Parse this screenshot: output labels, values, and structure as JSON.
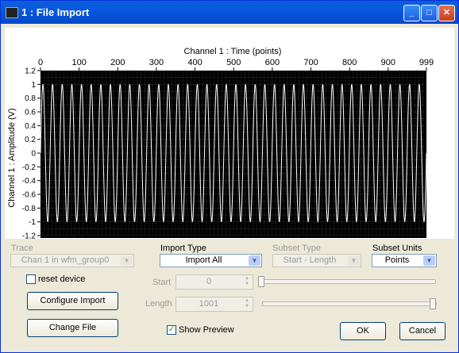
{
  "window": {
    "title": "1 : File Import",
    "minimize": "_",
    "maximize": "□",
    "close": "✕"
  },
  "chart_data": {
    "type": "line",
    "title": "",
    "xlabel": "Channel 1 : Time (points)",
    "ylabel": "Channel 1 : Amplitude (V)",
    "xlim": [
      0,
      999
    ],
    "ylim": [
      -1.2,
      1.2
    ],
    "xticks": [
      "0",
      "100",
      "200",
      "300",
      "400",
      "500",
      "600",
      "700",
      "800",
      "900",
      "999"
    ],
    "yticks": [
      "1.2",
      "1",
      "0.8",
      "0.6",
      "0.4",
      "0.2",
      "0",
      "-0.2",
      "-0.4",
      "-0.6",
      "-0.8",
      "-1",
      "-1.2"
    ],
    "series": [
      {
        "amplitude": 1,
        "cycles": 40,
        "color": "#ffffff"
      }
    ],
    "grid": true,
    "background": "#000000"
  },
  "trace": {
    "label": "Trace",
    "value": "Chan 1 in wfm_group0"
  },
  "import_type": {
    "label": "Import Type",
    "value": "Import All"
  },
  "subset_type": {
    "label": "Subset Type",
    "value": "Start - Length"
  },
  "subset_units": {
    "label": "Subset Units",
    "value": "Points"
  },
  "reset_device": {
    "label": "reset device"
  },
  "start": {
    "label": "Start",
    "value": "0"
  },
  "length": {
    "label": "Length",
    "value": "1001"
  },
  "buttons": {
    "configure": "Configure Import",
    "change_file": "Change File",
    "ok": "OK",
    "cancel": "Cancel"
  },
  "show_preview": {
    "label": "Show Preview",
    "checked": "✓"
  }
}
